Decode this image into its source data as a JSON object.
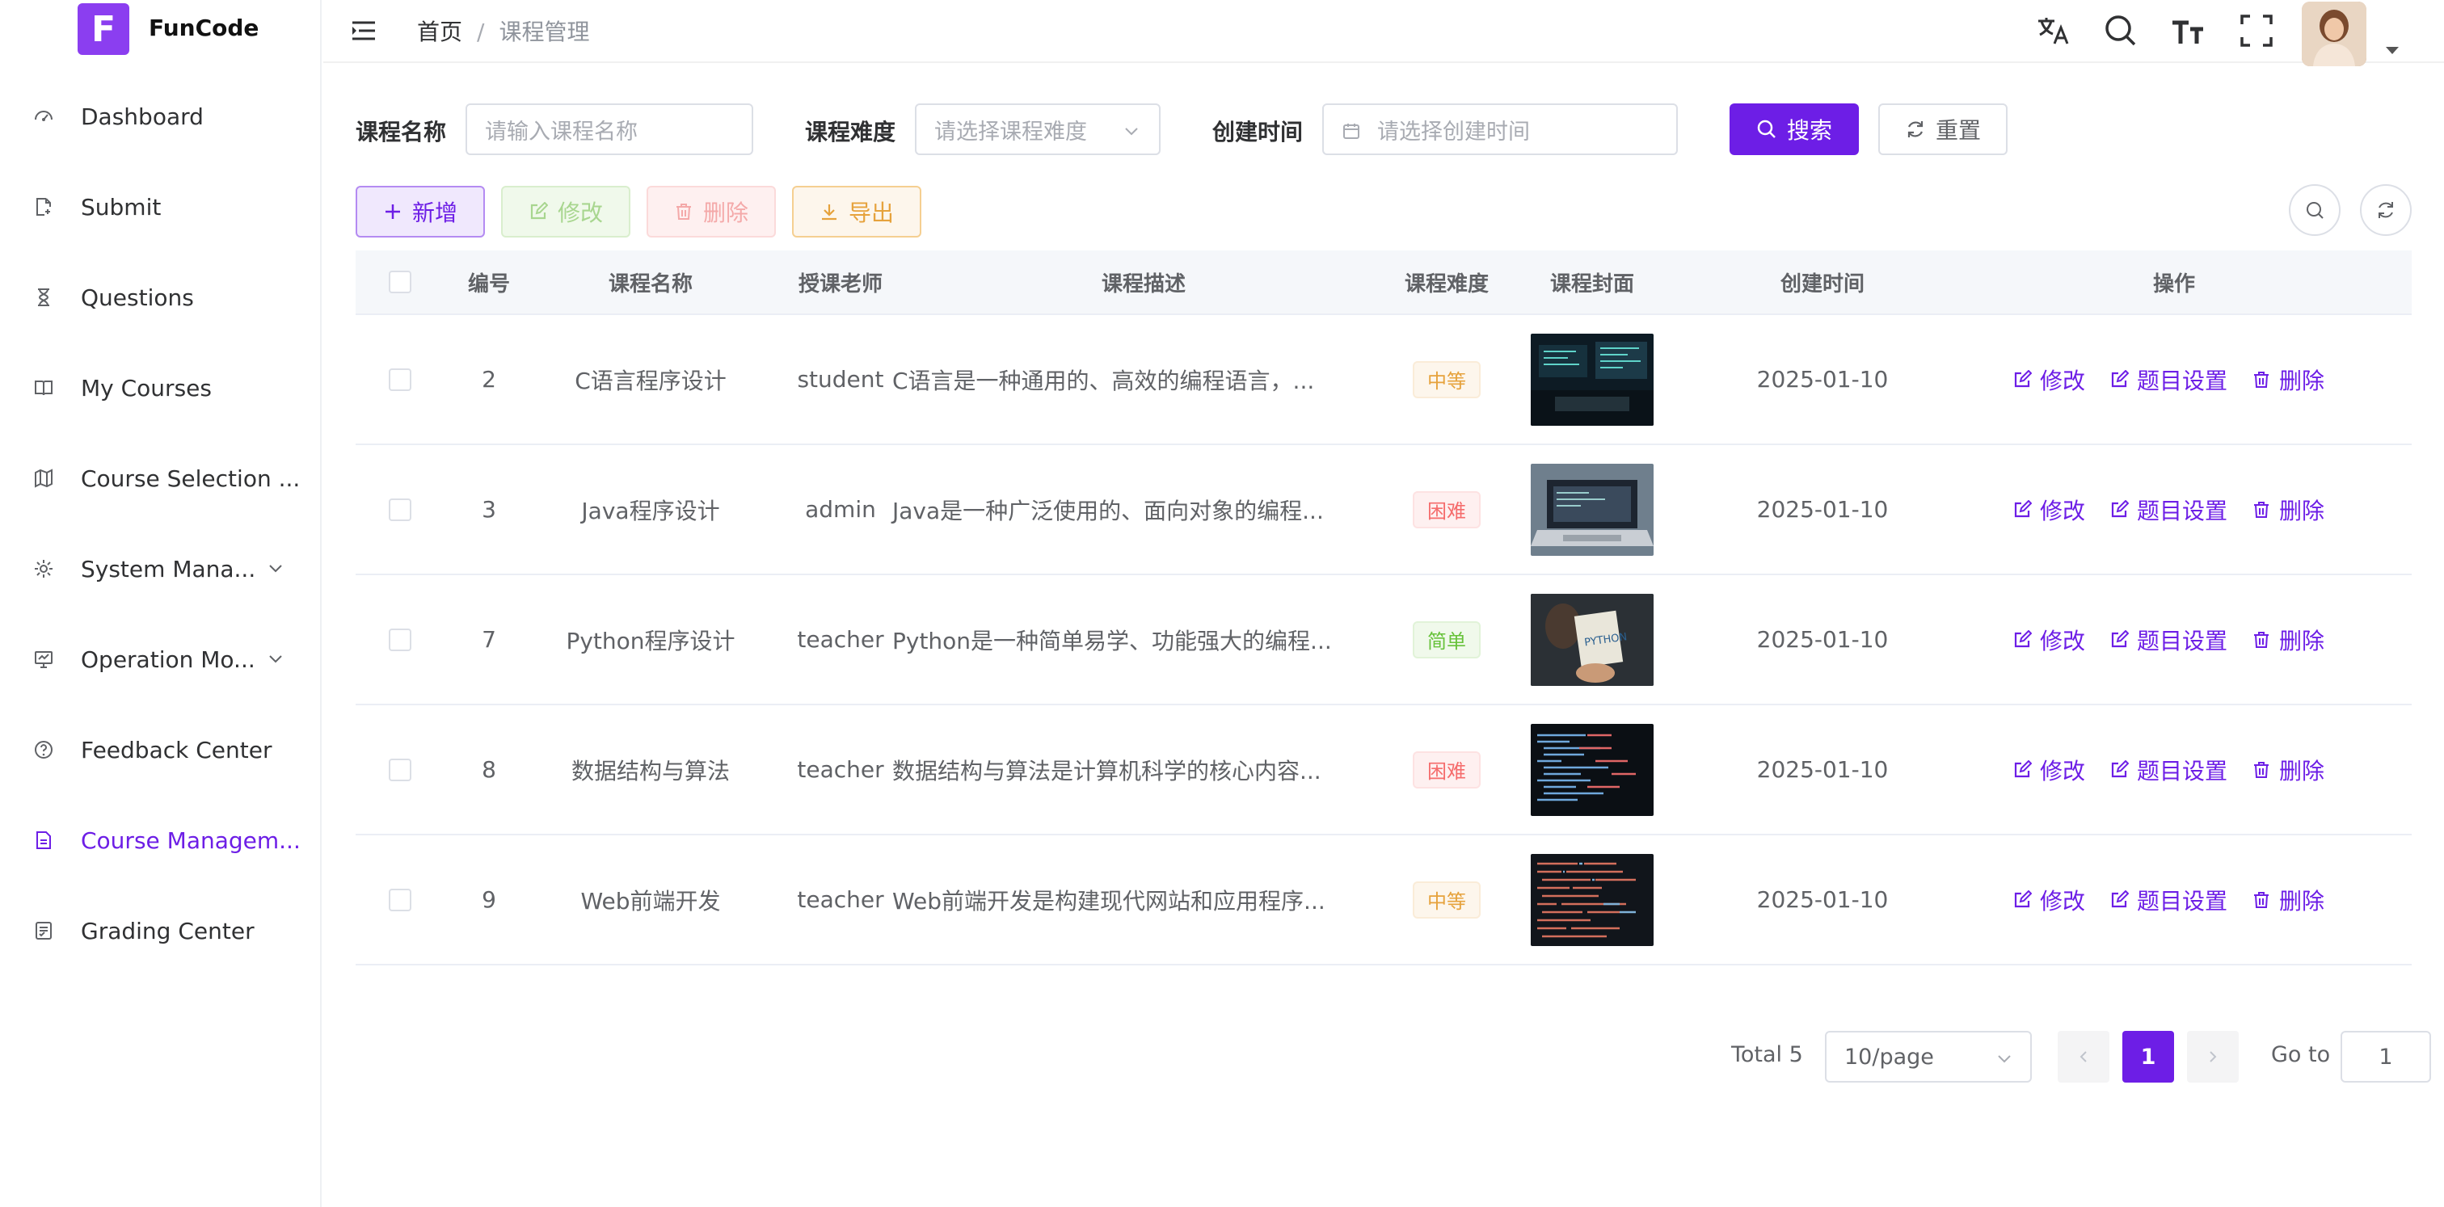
{
  "app": {
    "logo_letter": "F",
    "name": "FunCode"
  },
  "sidebar": {
    "items": [
      {
        "label": "Dashboard",
        "icon": "dashboard-icon",
        "active": false
      },
      {
        "label": "Submit",
        "icon": "file-edit-icon",
        "active": false
      },
      {
        "label": "Questions",
        "icon": "hourglass-icon",
        "active": false
      },
      {
        "label": "My Courses",
        "icon": "book-icon",
        "active": false
      },
      {
        "label": "Course Selection ...",
        "icon": "map-icon",
        "active": false
      },
      {
        "label": "System Mana...",
        "icon": "gear-icon",
        "active": false,
        "expandable": true
      },
      {
        "label": "Operation Mo...",
        "icon": "monitor-icon",
        "active": false,
        "expandable": true
      },
      {
        "label": "Feedback Center",
        "icon": "question-circle-icon",
        "active": false
      },
      {
        "label": "Course Managem...",
        "icon": "document-icon",
        "active": true
      },
      {
        "label": "Grading Center",
        "icon": "list-check-icon",
        "active": false
      }
    ]
  },
  "header": {
    "breadcrumb": [
      "首页",
      "课程管理"
    ],
    "breadcrumb_separator": "/",
    "icons": [
      "translate-icon",
      "search-icon",
      "font-size-icon",
      "fullscreen-icon"
    ]
  },
  "search": {
    "name_label": "课程名称",
    "name_placeholder": "请输入课程名称",
    "difficulty_label": "课程难度",
    "difficulty_placeholder": "请选择课程难度",
    "time_label": "创建时间",
    "time_placeholder": "请选择创建时间",
    "search_btn": "搜索",
    "reset_btn": "重置"
  },
  "toolbar": {
    "add": "新增",
    "edit": "修改",
    "delete": "删除",
    "export": "导出"
  },
  "table": {
    "columns": [
      "编号",
      "课程名称",
      "授课老师",
      "课程描述",
      "课程难度",
      "课程封面",
      "创建时间",
      "操作"
    ],
    "rows": [
      {
        "id": "2",
        "name": "C语言程序设计",
        "teacher": "student",
        "desc": "C语言是一种通用的、高效的编程语言，...",
        "difficulty": "中等",
        "level": "med",
        "created": "2025-01-10"
      },
      {
        "id": "3",
        "name": "Java程序设计",
        "teacher": "admin",
        "desc": "Java是一种广泛使用的、面向对象的编程...",
        "difficulty": "困难",
        "level": "hard",
        "created": "2025-01-10"
      },
      {
        "id": "7",
        "name": "Python程序设计",
        "teacher": "teacher",
        "desc": "Python是一种简单易学、功能强大的编程...",
        "difficulty": "简单",
        "level": "easy",
        "created": "2025-01-10"
      },
      {
        "id": "8",
        "name": "数据结构与算法",
        "teacher": "teacher",
        "desc": "数据结构与算法是计算机科学的核心内容...",
        "difficulty": "困难",
        "level": "hard",
        "created": "2025-01-10"
      },
      {
        "id": "9",
        "name": "Web前端开发",
        "teacher": "teacher",
        "desc": "Web前端开发是构建现代网站和应用程序...",
        "difficulty": "中等",
        "level": "med",
        "created": "2025-01-10"
      }
    ],
    "actions": {
      "edit": "修改",
      "settings": "题目设置",
      "delete": "删除"
    }
  },
  "pagination": {
    "total": "Total 5",
    "page_size": "10/page",
    "current": "1",
    "goto_label": "Go to",
    "goto_value": "1"
  },
  "colors": {
    "primary": "#6d1ee6",
    "logo": "#8b3ef0"
  }
}
